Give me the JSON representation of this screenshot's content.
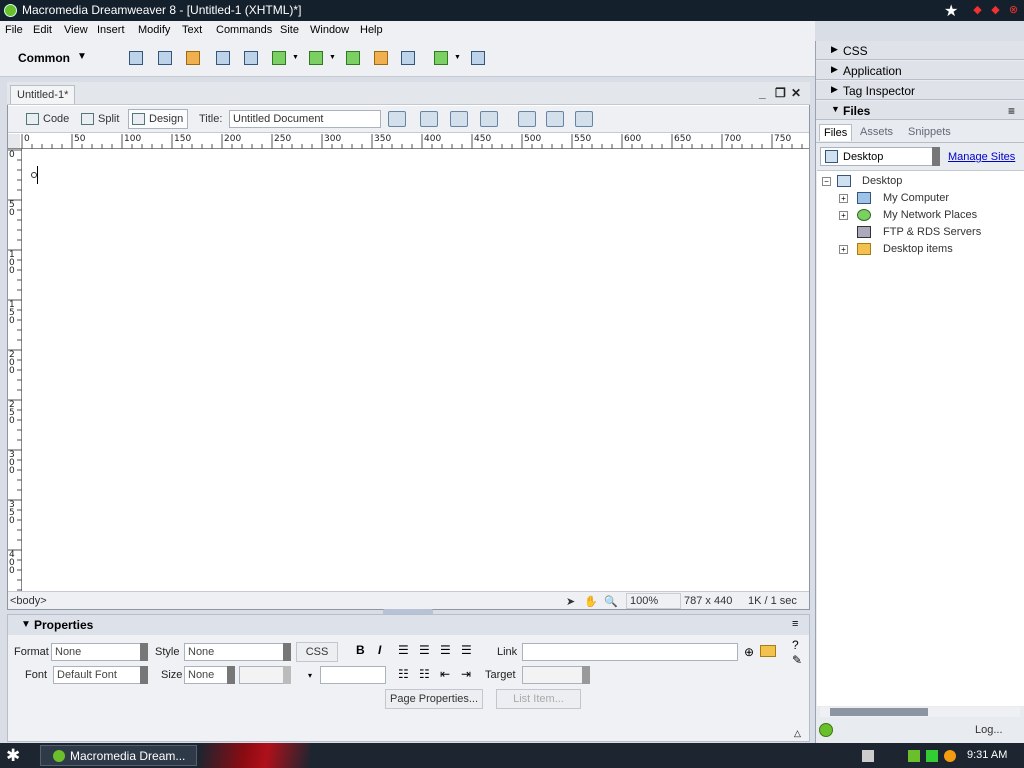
{
  "window": {
    "title": "Macromedia Dreamweaver 8 - [Untitled-1 (XHTML)*]"
  },
  "menu": [
    "File",
    "Edit",
    "View",
    "Insert",
    "Modify",
    "Text",
    "Commands",
    "Site",
    "Window",
    "Help"
  ],
  "insert_bar": {
    "category": "Common"
  },
  "document": {
    "tab": "Untitled-1*",
    "views": {
      "code": "Code",
      "split": "Split",
      "design": "Design"
    },
    "title_label": "Title:",
    "title_value": "Untitled Document",
    "ruler_h": [
      "0",
      "50",
      "100",
      "150",
      "200",
      "250",
      "300",
      "350",
      "400",
      "450",
      "500",
      "550",
      "600",
      "650",
      "700",
      "750"
    ],
    "ruler_v": [
      "0",
      "50",
      "100",
      "150",
      "200",
      "250",
      "300",
      "350",
      "400"
    ]
  },
  "status": {
    "tag": "<body>",
    "zoom": "100%",
    "size": "787 x 440",
    "download": "1K / 1 sec"
  },
  "properties": {
    "header": "Properties",
    "format_label": "Format",
    "format_value": "None",
    "style_label": "Style",
    "style_value": "None",
    "css_button": "CSS",
    "bold": "B",
    "italic": "I",
    "link_label": "Link",
    "link_value": "",
    "font_label": "Font",
    "font_value": "Default Font",
    "size_label": "Size",
    "size_value": "None",
    "target_label": "Target",
    "page_properties": "Page Properties...",
    "list_item": "List Item..."
  },
  "panels": {
    "css": "CSS",
    "application": "Application",
    "tag_inspector": "Tag Inspector",
    "files": "Files",
    "files_tabs": [
      "Files",
      "Assets",
      "Snippets"
    ],
    "site": "Desktop",
    "manage_sites": "Manage Sites",
    "tree": {
      "root": "Desktop",
      "items": [
        "My Computer",
        "My Network Places",
        "FTP & RDS Servers",
        "Desktop items"
      ]
    },
    "log": "Log..."
  },
  "taskbar": {
    "task": "Macromedia Dream...",
    "clock": "9:31 AM"
  }
}
